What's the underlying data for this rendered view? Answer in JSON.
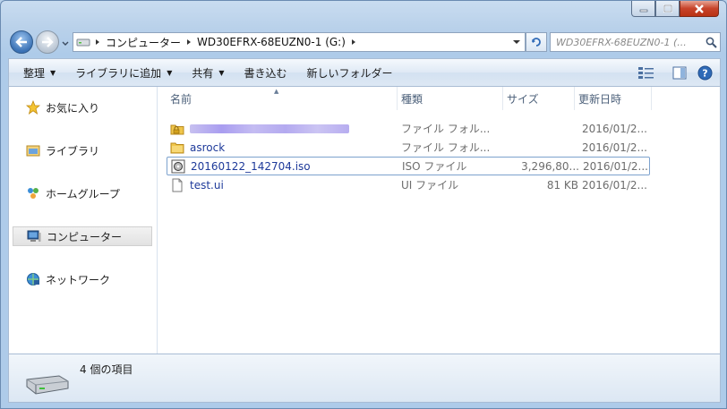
{
  "address": {
    "parts": [
      "コンピューター",
      "WD30EFRX-68EUZN0-1 (G:)"
    ]
  },
  "search": {
    "placeholder": "WD30EFRX-68EUZN0-1 (..."
  },
  "toolbar": {
    "organize": "整理",
    "add_to_library": "ライブラリに追加",
    "share": "共有",
    "burn": "書き込む",
    "new_folder": "新しいフォルダー"
  },
  "nav": {
    "favorites": "お気に入り",
    "libraries": "ライブラリ",
    "homegroup": "ホームグループ",
    "computer": "コンピューター",
    "network": "ネットワーク"
  },
  "columns": {
    "name": "名前",
    "type": "種類",
    "size": "サイズ",
    "date": "更新日時"
  },
  "files": [
    {
      "name": "",
      "type": "ファイル フォル...",
      "size": "",
      "date": "2016/01/2...",
      "icon": "locked-folder-icon",
      "blurred": true
    },
    {
      "name": "asrock",
      "type": "ファイル フォル...",
      "size": "",
      "date": "2016/01/2...",
      "icon": "folder-icon"
    },
    {
      "name": "20160122_142704.iso",
      "type": "ISO ファイル",
      "size": "3,296,80...",
      "date": "2016/01/2...",
      "icon": "disc-image-icon",
      "focused": true
    },
    {
      "name": "test.ui",
      "type": "UI ファイル",
      "size": "81 KB",
      "date": "2016/01/2...",
      "icon": "file-icon"
    }
  ],
  "status": {
    "count": "4 個の項目"
  },
  "colors": {
    "accent": "#3b72b5",
    "link_text": "#1e3a9a",
    "close_button": "#c7432a"
  }
}
